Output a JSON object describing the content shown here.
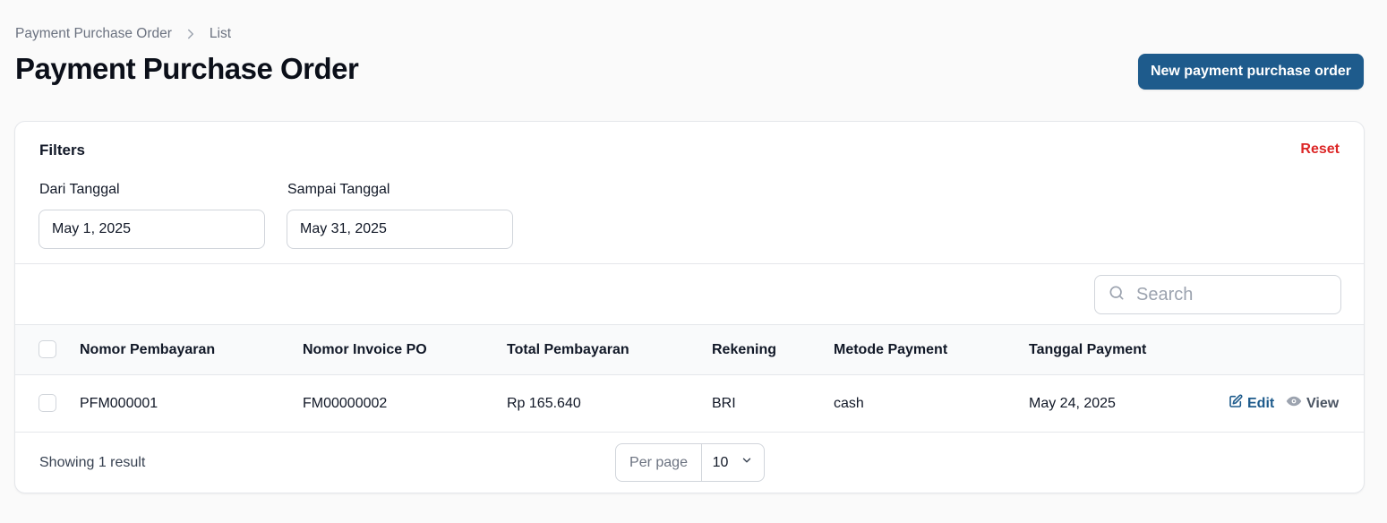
{
  "breadcrumb": {
    "items": [
      "Payment Purchase Order",
      "List"
    ]
  },
  "page": {
    "title": "Payment Purchase Order",
    "new_button_label": "New payment purchase order"
  },
  "filters": {
    "title": "Filters",
    "reset_label": "Reset",
    "from_date": {
      "label": "Dari Tanggal",
      "value": "May 1, 2025"
    },
    "to_date": {
      "label": "Sampai Tanggal",
      "value": "May 31, 2025"
    }
  },
  "search": {
    "placeholder": "Search"
  },
  "table": {
    "columns": [
      "Nomor Pembayaran",
      "Nomor Invoice PO",
      "Total Pembayaran",
      "Rekening",
      "Metode Payment",
      "Tanggal Payment"
    ],
    "rows": [
      {
        "nomor_pembayaran": "PFM000001",
        "nomor_invoice_po": "FM00000002",
        "total_pembayaran": "Rp 165.640",
        "rekening": "BRI",
        "metode_payment": "cash",
        "tanggal_payment": "May 24, 2025"
      }
    ],
    "actions": {
      "edit_label": "Edit",
      "view_label": "View"
    }
  },
  "footer": {
    "showing": "Showing 1 result",
    "per_page_label": "Per page",
    "per_page_value": "10"
  },
  "colors": {
    "primary": "#1e5b8c",
    "danger": "#dc2626"
  }
}
